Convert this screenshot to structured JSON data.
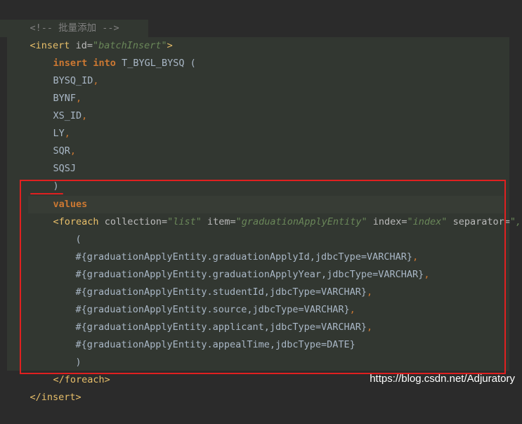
{
  "code": {
    "comment": "<!-- 批量添加 -->",
    "open_tag": "<insert",
    "id_attr": "id",
    "id_value": "\"batchInsert\"",
    "open_tag_end": ">",
    "insert_kw": "insert into",
    "table_name": "T_BYGL_BYSQ (",
    "columns": [
      "BYSQ_ID",
      "BYNF",
      "XS_ID",
      "LY",
      "SQR",
      "SQSJ"
    ],
    "close_paren": ")",
    "values_kw": "values",
    "foreach_open": "<foreach",
    "collection_attr": "collection=",
    "collection_value": "\"list\"",
    "item_attr": "item=",
    "item_value": "\"graduationApplyEntity\"",
    "index_attr": "index=",
    "index_value": "\"index\"",
    "separator_attr": "separator=",
    "separator_value": "\",\"",
    "foreach_open_end": ">",
    "inner_open_paren": "(",
    "params": [
      "#{graduationApplyEntity.graduationApplyId,jdbcType=VARCHAR}",
      "#{graduationApplyEntity.graduationApplyYear,jdbcType=VARCHAR}",
      "#{graduationApplyEntity.studentId,jdbcType=VARCHAR}",
      "#{graduationApplyEntity.source,jdbcType=VARCHAR}",
      "#{graduationApplyEntity.applicant,jdbcType=VARCHAR}",
      "#{graduationApplyEntity.appealTime,jdbcType=DATE}"
    ],
    "inner_close_paren": ")",
    "foreach_close": "</foreach>",
    "insert_close": "</insert>",
    "comma": ","
  },
  "watermark": "https://blog.csdn.net/Adjuratory",
  "colors": {
    "background": "#2b2b2b",
    "tag": "#e8bf6a",
    "keyword": "#cc7832",
    "string": "#6a8759",
    "comment": "#808080",
    "highlight_box": "#e02020"
  }
}
